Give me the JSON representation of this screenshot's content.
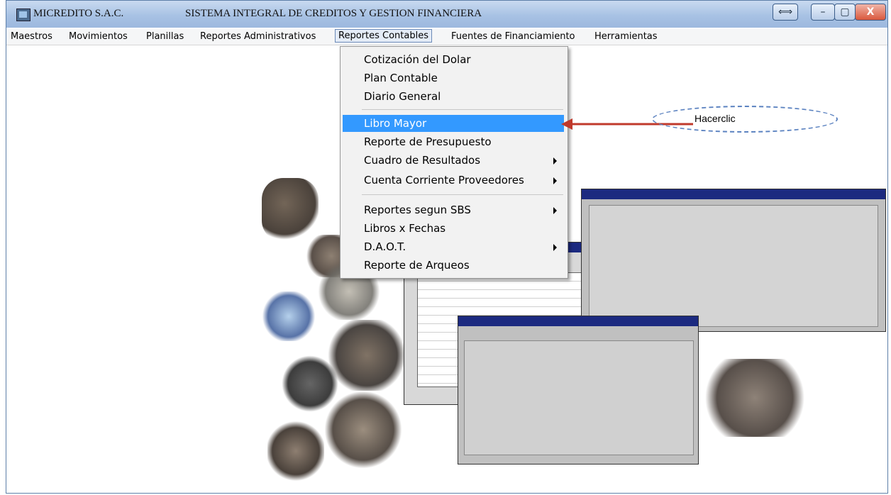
{
  "window": {
    "company": "MICREDITO S.A.C.",
    "system_title": "SISTEMA INTEGRAL DE CREDITOS Y GESTION FINANCIERA",
    "buttons": {
      "resize": "⟺",
      "minimize": "–",
      "maximize": "▢",
      "close": "X"
    }
  },
  "menubar": [
    {
      "label": "Maestros"
    },
    {
      "label": "Movimientos"
    },
    {
      "label": "Planillas"
    },
    {
      "label": "Reportes Administrativos"
    },
    {
      "label": "Reportes Contables",
      "active": true
    },
    {
      "label": "Fuentes de Financiamiento"
    },
    {
      "label": "Herramientas"
    }
  ],
  "dropdown": {
    "items": [
      {
        "label": "Cotización del Dolar",
        "submenu": false
      },
      {
        "label": "Plan Contable",
        "submenu": false
      },
      {
        "label": "Diario General",
        "submenu": false
      },
      {
        "label": "Libro Mayor",
        "submenu": false,
        "highlighted": true
      },
      {
        "label": "Reporte de Presupuesto",
        "submenu": false
      },
      {
        "label": "Cuadro de Resultados",
        "submenu": true
      },
      {
        "label": "Cuenta Corriente Proveedores",
        "submenu": true
      },
      {
        "label": "Reportes segun SBS",
        "submenu": true
      },
      {
        "label": "Libros x Fechas",
        "submenu": false
      },
      {
        "label": "D.A.O.T.",
        "submenu": true
      },
      {
        "label": "Reporte de Arqueos",
        "submenu": false
      }
    ]
  },
  "annotation": {
    "text": "Hacerclic",
    "arrow_color": "#c0392b"
  },
  "colors": {
    "title_gradient_top": "#c9daf0",
    "highlight": "#3399ff",
    "screen_navy": "#1c2a80"
  }
}
